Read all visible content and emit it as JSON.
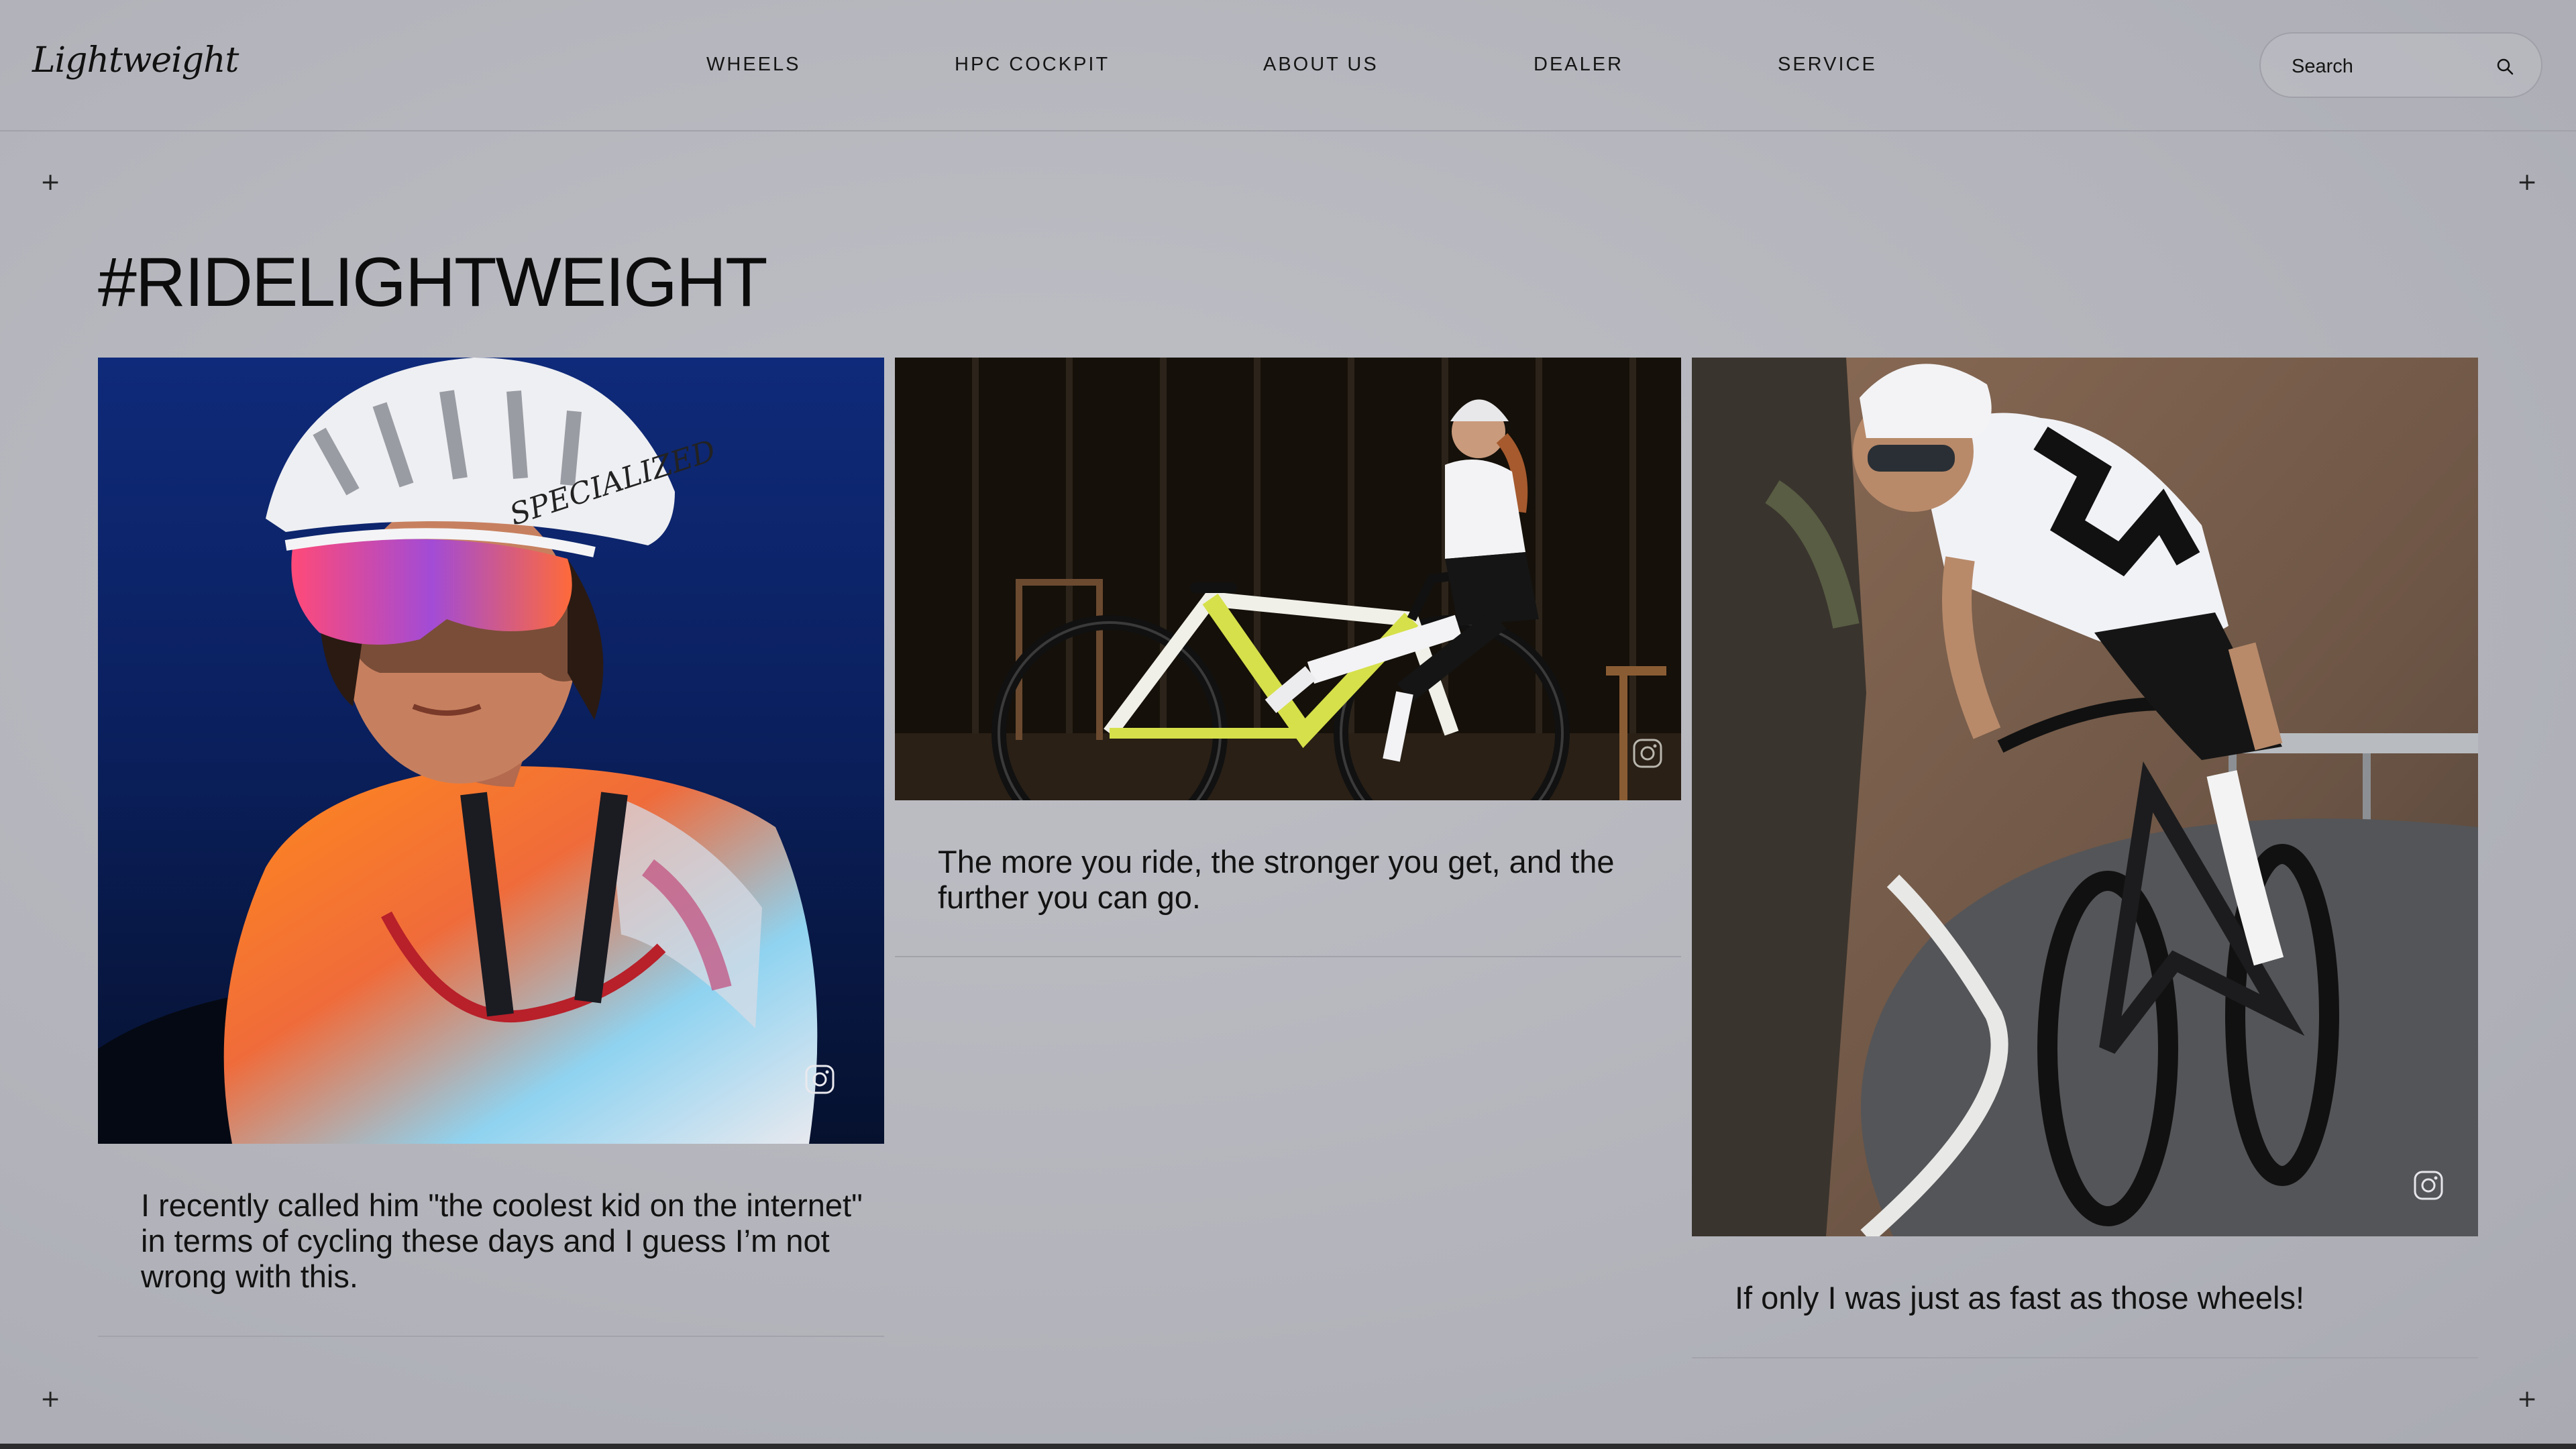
{
  "brand": {
    "logo_text": "Lightweight"
  },
  "nav": {
    "items": [
      {
        "label": "WHEELS"
      },
      {
        "label": "HPC COCKPIT"
      },
      {
        "label": "ABOUT US"
      },
      {
        "label": "DEALER"
      },
      {
        "label": "SERVICE"
      }
    ]
  },
  "search": {
    "placeholder": "Search",
    "icon": "search-icon"
  },
  "page": {
    "title": "#RIDELIGHTWEIGHT"
  },
  "posts": [
    {
      "caption": "I recently called him \"the coolest kid on the internet\" in terms of cycling these days and I guess I’m not wrong with this.",
      "icon": "instagram-icon"
    },
    {
      "caption": "The more you ride, the stronger you get, and the further you can go.",
      "icon": "instagram-icon"
    },
    {
      "caption": "If only I was just as fast as those wheels!",
      "icon": "instagram-icon"
    }
  ],
  "colors": {
    "background": "#b5b6bd",
    "text": "#111111",
    "divider": "#a3a4ab"
  }
}
